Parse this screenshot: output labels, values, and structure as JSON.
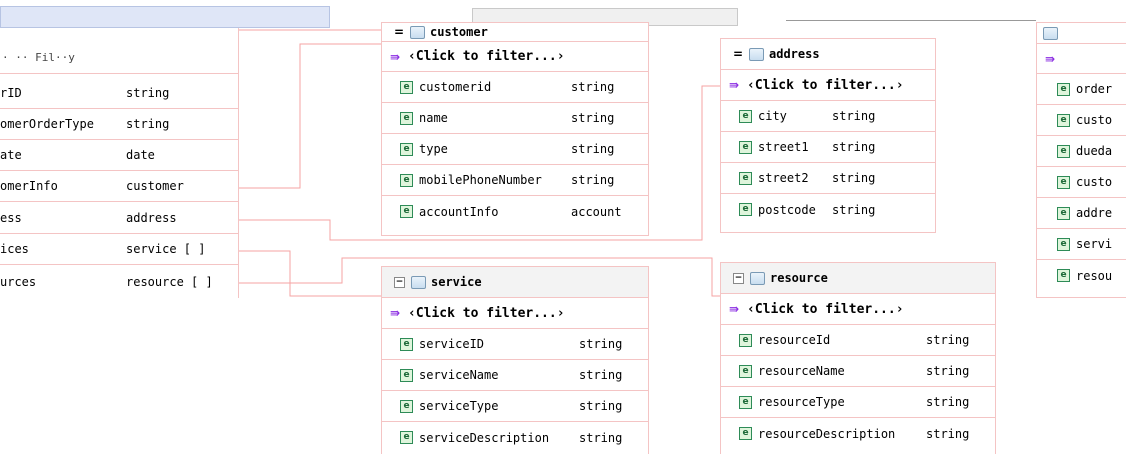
{
  "left_table": {
    "title_fragment": "",
    "filter_fragment": "· ·· Fil··y",
    "rows": [
      {
        "name": "rID",
        "type": "string"
      },
      {
        "name": "omerOrderType",
        "type": "string"
      },
      {
        "name": "ate",
        "type": "date"
      },
      {
        "name": "omerInfo",
        "type": "customer"
      },
      {
        "name": "ess",
        "type": "address"
      },
      {
        "name": "ices",
        "type": "service [ ]"
      },
      {
        "name": "urces",
        "type": "resource [ ]"
      }
    ]
  },
  "customer": {
    "title": "customer",
    "filter": "Click to filter...",
    "fields": [
      {
        "name": "customerid",
        "type": "string"
      },
      {
        "name": "name",
        "type": "string"
      },
      {
        "name": "type",
        "type": "string"
      },
      {
        "name": "mobilePhoneNumber",
        "type": "string"
      },
      {
        "name": "accountInfo",
        "type": "account"
      }
    ]
  },
  "address": {
    "title": "address",
    "filter": "Click to filter...",
    "fields": [
      {
        "name": "city",
        "type": "string"
      },
      {
        "name": "street1",
        "type": "string"
      },
      {
        "name": "street2",
        "type": "string"
      },
      {
        "name": "postcode",
        "type": "string"
      }
    ]
  },
  "service": {
    "title": "service",
    "filter": "Click to filter...",
    "fields": [
      {
        "name": "serviceID",
        "type": "string"
      },
      {
        "name": "serviceName",
        "type": "string"
      },
      {
        "name": "serviceType",
        "type": "string"
      },
      {
        "name": "serviceDescription",
        "type": "string"
      }
    ]
  },
  "resource": {
    "title": "resource",
    "filter": "Click to filter...",
    "fields": [
      {
        "name": "resourceId",
        "type": "string"
      },
      {
        "name": "resourceName",
        "type": "string"
      },
      {
        "name": "resourceType",
        "type": "string"
      },
      {
        "name": "resourceDescription",
        "type": "string"
      }
    ]
  },
  "right_table": {
    "rows": [
      "order",
      "custo",
      "dueda",
      "custo",
      "addre",
      "servi",
      "resou"
    ]
  },
  "colors": {
    "border": "#f4c4c4",
    "link": "#f6a3a3",
    "header_bg": "#f3f3f3",
    "element_icon": "#2e8b57"
  }
}
